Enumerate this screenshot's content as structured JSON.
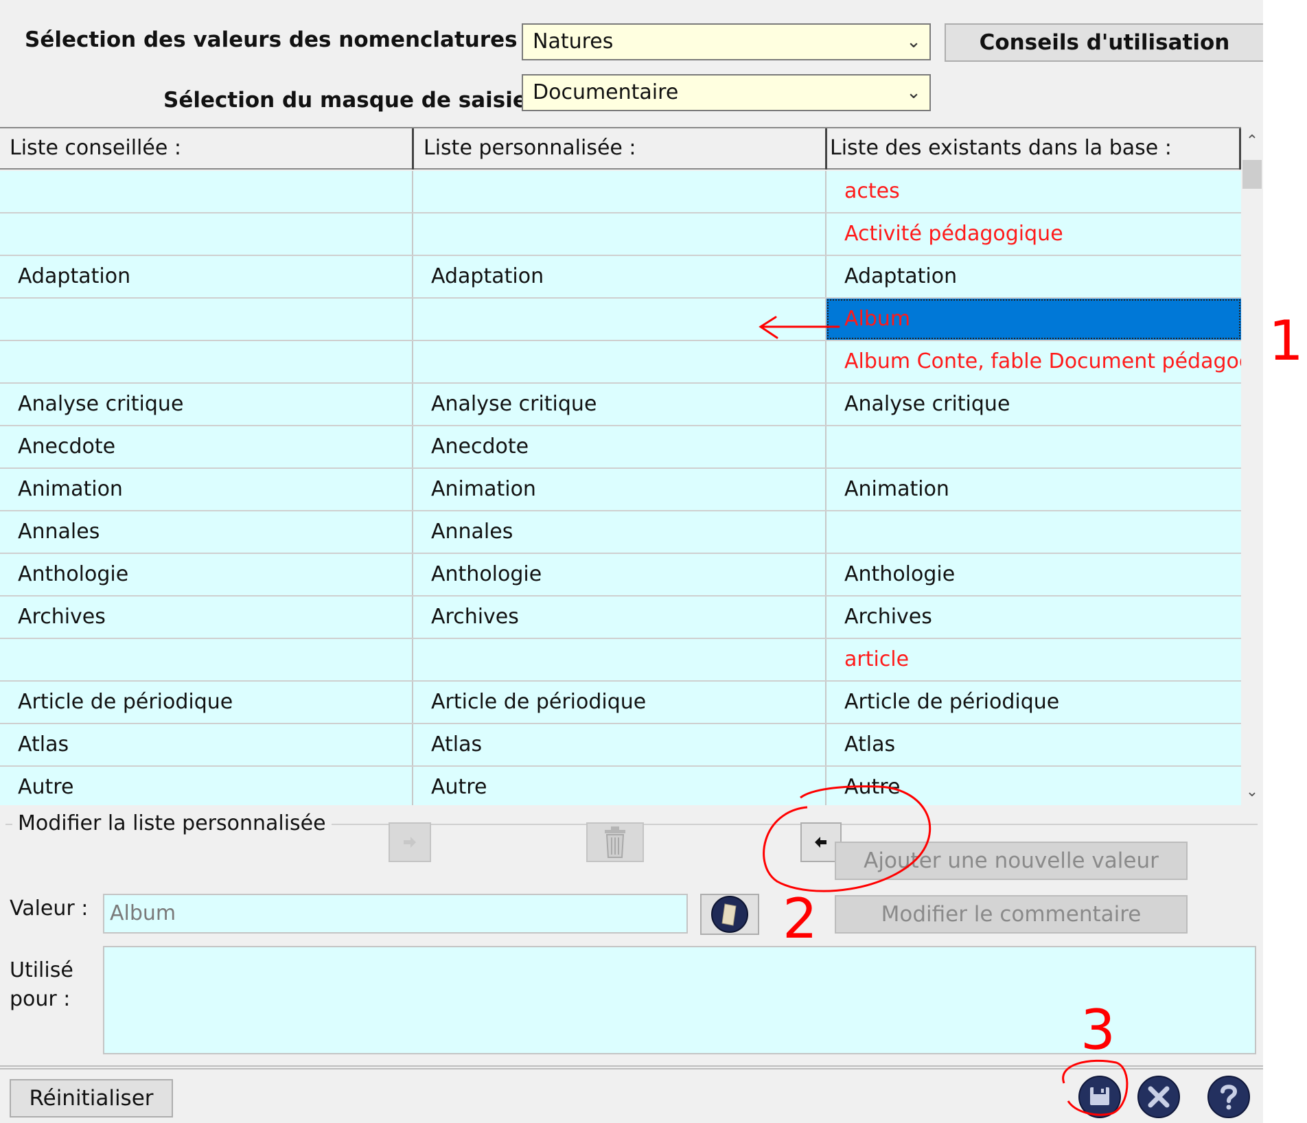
{
  "header": {
    "nomenclature_label": "Sélection des valeurs des nomenclatures",
    "nomenclature_value": "Natures",
    "masque_label": "Sélection du masque de saisie :",
    "masque_value": "Documentaire",
    "conseils_button": "Conseils d'utilisation"
  },
  "grid": {
    "columns": [
      "Liste conseillée :",
      "Liste personnalisée :",
      "Liste des existants dans la base :"
    ],
    "rows": [
      {
        "c1": "",
        "c2": "",
        "c3": "actes",
        "red": true
      },
      {
        "c1": "",
        "c2": "",
        "c3": "Activité pédagogique",
        "red": true
      },
      {
        "c1": "Adaptation",
        "c2": "Adaptation",
        "c3": "Adaptation",
        "red": false
      },
      {
        "c1": "",
        "c2": "",
        "c3": "Album",
        "red": true,
        "selected": true
      },
      {
        "c1": "",
        "c2": "",
        "c3": "Album Conte, fable Document pédagogique",
        "red": true
      },
      {
        "c1": "Analyse critique",
        "c2": "Analyse critique",
        "c3": "Analyse critique",
        "red": false
      },
      {
        "c1": "Anecdote",
        "c2": "Anecdote",
        "c3": "",
        "red": false
      },
      {
        "c1": "Animation",
        "c2": "Animation",
        "c3": "Animation",
        "red": false
      },
      {
        "c1": "Annales",
        "c2": "Annales",
        "c3": "",
        "red": false
      },
      {
        "c1": "Anthologie",
        "c2": "Anthologie",
        "c3": "Anthologie",
        "red": false
      },
      {
        "c1": "Archives",
        "c2": "Archives",
        "c3": "Archives",
        "red": false
      },
      {
        "c1": "",
        "c2": "",
        "c3": "article",
        "red": true
      },
      {
        "c1": "Article de périodique",
        "c2": "Article de périodique",
        "c3": "Article de périodique",
        "red": false
      },
      {
        "c1": "Atlas",
        "c2": "Atlas",
        "c3": "Atlas",
        "red": false
      },
      {
        "c1": "Autre",
        "c2": "Autre",
        "c3": "Autre",
        "red": false
      }
    ]
  },
  "edit": {
    "group_label": "Modifier la liste personnalisée",
    "add_value_button": "Ajouter une nouvelle valeur",
    "modify_comment_button": "Modifier le commentaire",
    "valeur_label": "Valeur :",
    "valeur_value": "Album",
    "utilise_label_1": "Utilisé",
    "utilise_label_2": "pour :"
  },
  "footer": {
    "reset_button": "Réinitialiser"
  },
  "annotations": {
    "mark_1": "1",
    "mark_2": "2",
    "mark_3": "3",
    "color": "#ff0000"
  },
  "icons": [
    "arrow-right-icon",
    "trash-icon",
    "arrow-left-icon",
    "notepad-icon",
    "save-icon",
    "close-icon",
    "help-icon"
  ]
}
